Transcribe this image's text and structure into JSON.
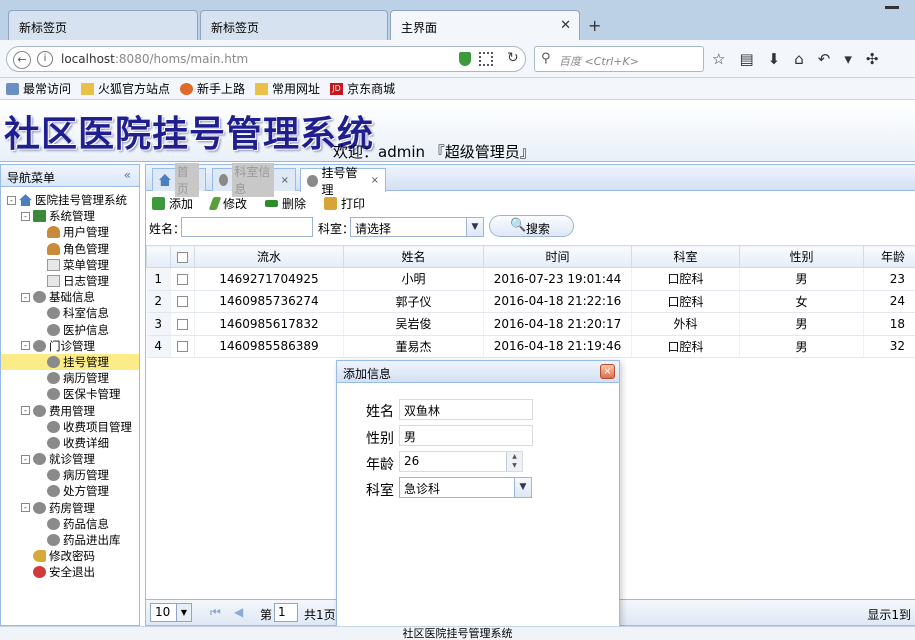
{
  "browser": {
    "tabs": [
      {
        "label": "新标签页"
      },
      {
        "label": "新标签页"
      },
      {
        "label": "主界面"
      }
    ],
    "url_host": "localhost",
    "url_rest": ":8080/homs/main.htm",
    "search_placeholder": "百度 <Ctrl+K>",
    "bookmarks": [
      "最常访问",
      "火狐官方站点",
      "新手上路",
      "常用网址",
      "京东商城"
    ]
  },
  "app": {
    "title": "社区医院挂号管理系统",
    "welcome": "欢迎：admin 『超级管理员』",
    "footer": "社区医院挂号管理系统"
  },
  "sidebar": {
    "title": "导航菜单",
    "collapse": "«",
    "tree": [
      {
        "label": "医院挂号管理系统",
        "icon": "house-icon",
        "level": 0,
        "toggle": "-"
      },
      {
        "label": "系统管理",
        "icon": "book-icon",
        "level": 1,
        "toggle": "-"
      },
      {
        "label": "用户管理",
        "icon": "user-icon",
        "level": 2
      },
      {
        "label": "角色管理",
        "icon": "user-icon",
        "level": 2
      },
      {
        "label": "菜单管理",
        "icon": "doc-icon",
        "level": 2
      },
      {
        "label": "日志管理",
        "icon": "doc-icon",
        "level": 2
      },
      {
        "label": "基础信息",
        "icon": "gear-icon",
        "level": 1,
        "toggle": "-"
      },
      {
        "label": "科室信息",
        "icon": "gear-icon",
        "level": 2
      },
      {
        "label": "医护信息",
        "icon": "gear-icon",
        "level": 2
      },
      {
        "label": "门诊管理",
        "icon": "gear-icon",
        "level": 1,
        "toggle": "-"
      },
      {
        "label": "挂号管理",
        "icon": "gear-icon",
        "level": 2,
        "selected": true
      },
      {
        "label": "病历管理",
        "icon": "gear-icon",
        "level": 2
      },
      {
        "label": "医保卡管理",
        "icon": "gear-icon",
        "level": 2
      },
      {
        "label": "费用管理",
        "icon": "gear-icon",
        "level": 1,
        "toggle": "-"
      },
      {
        "label": "收费项目管理",
        "icon": "gear-icon",
        "level": 2
      },
      {
        "label": "收费详细",
        "icon": "gear-icon",
        "level": 2
      },
      {
        "label": "就诊管理",
        "icon": "gear-icon",
        "level": 1,
        "toggle": "-"
      },
      {
        "label": "病历管理",
        "icon": "gear-icon",
        "level": 2
      },
      {
        "label": "处方管理",
        "icon": "gear-icon",
        "level": 2
      },
      {
        "label": "药房管理",
        "icon": "gear-icon",
        "level": 1,
        "toggle": "-"
      },
      {
        "label": "药品信息",
        "icon": "gear-icon",
        "level": 2
      },
      {
        "label": "药品进出库",
        "icon": "gear-icon",
        "level": 2
      },
      {
        "label": "修改密码",
        "icon": "key-icon",
        "level": 1
      },
      {
        "label": "安全退出",
        "icon": "exit-icon",
        "level": 1
      }
    ]
  },
  "panel": {
    "tabs": [
      {
        "label": "首页",
        "icon": "house-icon"
      },
      {
        "label": "科室信息",
        "icon": "gear-icon",
        "close": "×"
      },
      {
        "label": "挂号管理",
        "icon": "gear-icon",
        "close": "×"
      }
    ],
    "toolbar": [
      {
        "label": "添加",
        "icon": "add-icon",
        "color": "#3c9a3c"
      },
      {
        "label": "修改",
        "icon": "edit-icon",
        "color": "#5aa03a"
      },
      {
        "label": "删除",
        "icon": "delete-icon",
        "color": "#2f8a2f"
      },
      {
        "label": "打印",
        "icon": "print-icon",
        "color": "#d8a436"
      }
    ],
    "search": {
      "name_label": "姓名：",
      "name_value": "",
      "dept_label": "科室：",
      "dept_value": "请选择",
      "button": "搜索"
    },
    "grid": {
      "columns": [
        "流水",
        "姓名",
        "时间",
        "科室",
        "性别",
        "年龄"
      ],
      "rows": [
        {
          "no": "1",
          "serial": "1469271704925",
          "name": "小明",
          "time": "2016-07-23 19:01:44",
          "dept": "口腔科",
          "sex": "男",
          "age": "23"
        },
        {
          "no": "2",
          "serial": "1460985736274",
          "name": "郭子仪",
          "time": "2016-04-18 21:22:16",
          "dept": "口腔科",
          "sex": "女",
          "age": "24"
        },
        {
          "no": "3",
          "serial": "1460985617832",
          "name": "吴岩俊",
          "time": "2016-04-18 21:20:17",
          "dept": "外科",
          "sex": "男",
          "age": "18"
        },
        {
          "no": "4",
          "serial": "1460985586389",
          "name": "董易杰",
          "time": "2016-04-18 21:19:46",
          "dept": "口腔科",
          "sex": "男",
          "age": "32"
        }
      ]
    },
    "pager": {
      "page_size": "10",
      "page_label": "第",
      "page_value": "1",
      "total": "共1页",
      "display": "显示1到"
    }
  },
  "dialog": {
    "title": "添加信息",
    "close": "×",
    "fields": [
      {
        "label": "姓名",
        "value": "双鱼林"
      },
      {
        "label": "性别",
        "value": "男"
      },
      {
        "label": "年龄",
        "value": "26"
      },
      {
        "label": "科室",
        "value": "急诊科"
      }
    ]
  }
}
